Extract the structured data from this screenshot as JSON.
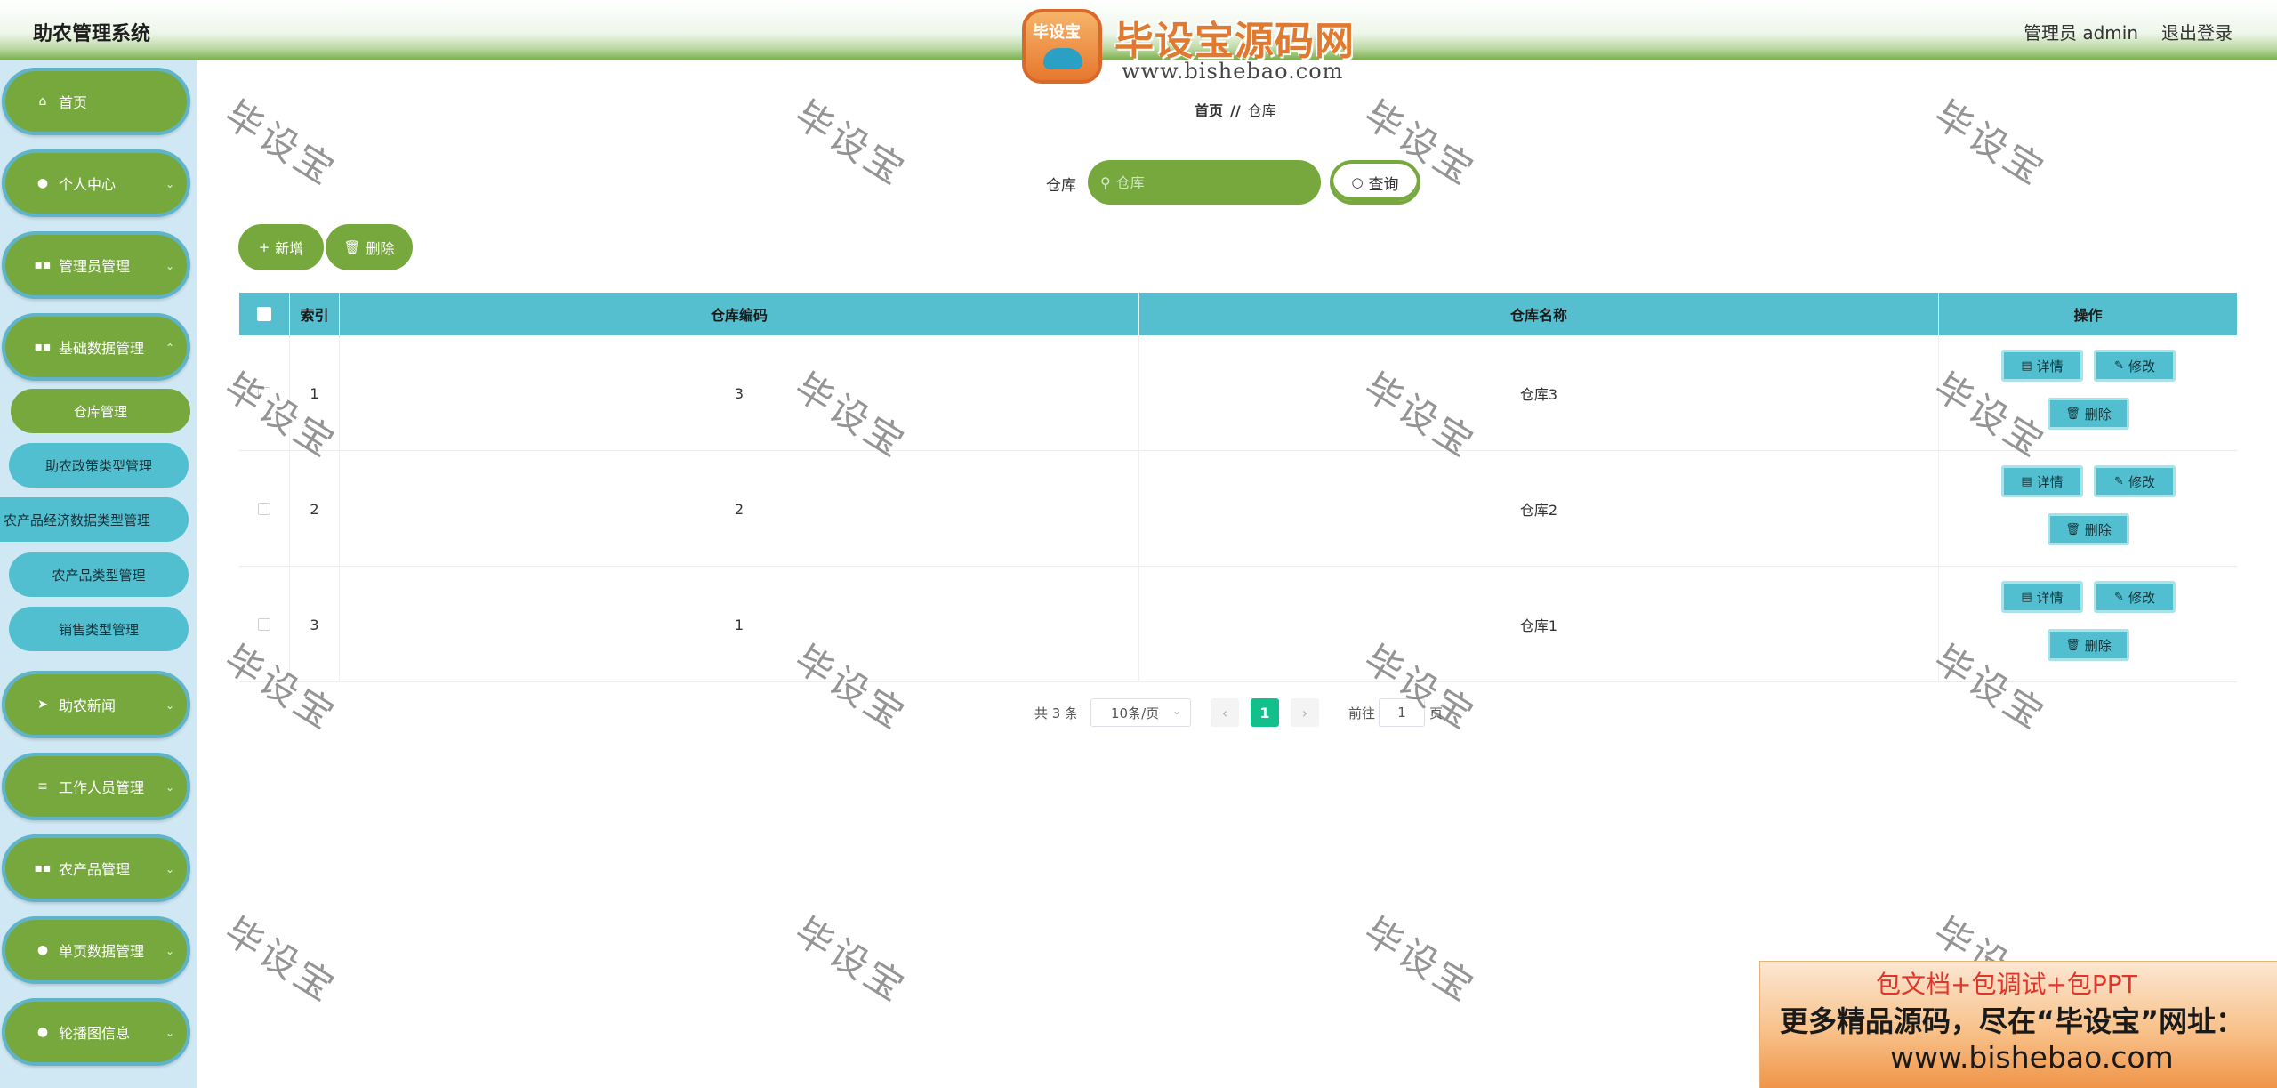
{
  "header": {
    "app_title": "助农管理系统",
    "user_label": "管理员 admin",
    "logout_label": "退出登录",
    "logo_badge": "毕设宝",
    "logo_main": "毕设宝源码网",
    "logo_url": "www.bishebao.com"
  },
  "sidebar": {
    "items": [
      {
        "label": "首页",
        "icon": "home-icon"
      },
      {
        "label": "个人中心",
        "icon": "user-icon"
      },
      {
        "label": "管理员管理",
        "icon": "grid-icon"
      },
      {
        "label": "基础数据管理",
        "icon": "grid-icon"
      },
      {
        "label": "助农新闻",
        "icon": "send-icon"
      },
      {
        "label": "工作人员管理",
        "icon": "list-icon"
      },
      {
        "label": "农产品管理",
        "icon": "grid-icon"
      },
      {
        "label": "单页数据管理",
        "icon": "location-icon"
      },
      {
        "label": "轮播图信息",
        "icon": "user-icon"
      }
    ],
    "sub_items": [
      {
        "label": "仓库管理",
        "active": true
      },
      {
        "label": "助农政策类型管理",
        "active": false
      },
      {
        "label": "农产品经济数据类型管理",
        "active": false
      },
      {
        "label": "农产品类型管理",
        "active": false
      },
      {
        "label": "销售类型管理",
        "active": false
      }
    ]
  },
  "breadcrumb": {
    "home": "首页",
    "separator": "//",
    "current": "仓库"
  },
  "search": {
    "label": "仓库",
    "placeholder": "仓库",
    "value": "",
    "button_label": "查询"
  },
  "toolbar": {
    "add_label": "新增",
    "delete_label": "删除"
  },
  "table": {
    "headers": [
      "索引",
      "仓库编码",
      "仓库名称",
      "操作"
    ],
    "rows": [
      {
        "index": "1",
        "code": "3",
        "name": "仓库3"
      },
      {
        "index": "2",
        "code": "2",
        "name": "仓库2"
      },
      {
        "index": "3",
        "code": "1",
        "name": "仓库1"
      }
    ],
    "row_actions": {
      "detail": "详情",
      "edit": "修改",
      "delete": "删除"
    }
  },
  "pagination": {
    "total_text": "共 3 条",
    "page_size": "10条/页",
    "current_page": "1",
    "goto_label": "前往",
    "goto_value": "1",
    "page_suffix": "页"
  },
  "watermark_text": "毕设宝",
  "promo": {
    "line1": "包文档+包调试+包PPT",
    "line2": "更多精品源码，尽在“毕设宝”网址：",
    "line3": "www.bishebao.com"
  },
  "colors": {
    "accent_green": "#76a83e",
    "accent_cyan": "#52bfd0",
    "table_header": "#55bfcf",
    "pager_current": "#13c08c"
  }
}
